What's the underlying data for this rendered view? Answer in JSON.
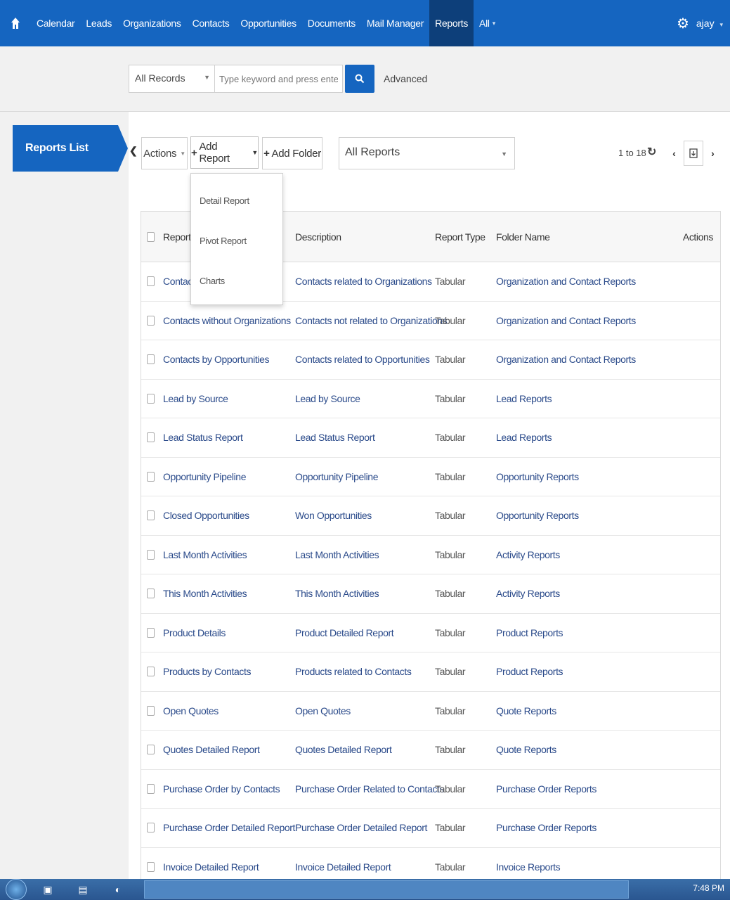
{
  "nav": {
    "items": [
      "Calendar",
      "Leads",
      "Organizations",
      "Contacts",
      "Opportunities",
      "Documents",
      "Mail Manager",
      "Reports",
      "All"
    ],
    "active": "Reports",
    "user": "ajay"
  },
  "search": {
    "records_select": "All Records",
    "placeholder": "Type keyword and press enter",
    "advanced_label": "Advanced"
  },
  "sidebar": {
    "title": "Reports List"
  },
  "toolbar": {
    "actions_label": "Actions",
    "add_report_label": "Add Report",
    "add_folder_label": "Add Folder",
    "folder_filter": "All Reports",
    "pager_text": "1 to 18"
  },
  "add_report_menu": [
    "Detail Report",
    "Pivot Report",
    "Charts"
  ],
  "table": {
    "headers": {
      "name": "Report Name",
      "description": "Description",
      "type": "Report Type",
      "folder": "Folder Name",
      "actions": "Actions"
    },
    "rows": [
      {
        "name": "Contacts by Organizations",
        "description": "Contacts related to Organizations",
        "type": "Tabular",
        "folder": "Organization and Contact Reports"
      },
      {
        "name": "Contacts without Organizations",
        "description": "Contacts not related to Organizations",
        "type": "Tabular",
        "folder": "Organization and Contact Reports"
      },
      {
        "name": "Contacts by Opportunities",
        "description": "Contacts related to Opportunities",
        "type": "Tabular",
        "folder": "Organization and Contact Reports"
      },
      {
        "name": "Lead by Source",
        "description": "Lead by Source",
        "type": "Tabular",
        "folder": "Lead Reports"
      },
      {
        "name": "Lead Status Report",
        "description": "Lead Status Report",
        "type": "Tabular",
        "folder": "Lead Reports"
      },
      {
        "name": "Opportunity Pipeline",
        "description": "Opportunity Pipeline",
        "type": "Tabular",
        "folder": "Opportunity Reports"
      },
      {
        "name": "Closed Opportunities",
        "description": "Won Opportunities",
        "type": "Tabular",
        "folder": "Opportunity Reports"
      },
      {
        "name": "Last Month Activities",
        "description": "Last Month Activities",
        "type": "Tabular",
        "folder": "Activity Reports"
      },
      {
        "name": "This Month Activities",
        "description": "This Month Activities",
        "type": "Tabular",
        "folder": "Activity Reports"
      },
      {
        "name": "Product Details",
        "description": "Product Detailed Report",
        "type": "Tabular",
        "folder": "Product Reports"
      },
      {
        "name": "Products by Contacts",
        "description": "Products related to Contacts",
        "type": "Tabular",
        "folder": "Product Reports"
      },
      {
        "name": "Open Quotes",
        "description": "Open Quotes",
        "type": "Tabular",
        "folder": "Quote Reports"
      },
      {
        "name": "Quotes Detailed Report",
        "description": "Quotes Detailed Report",
        "type": "Tabular",
        "folder": "Quote Reports"
      },
      {
        "name": "Purchase Order by Contacts",
        "description": "Purchase Order Related to Contacts",
        "type": "Tabular",
        "folder": "Purchase Order Reports"
      },
      {
        "name": "Purchase Order Detailed Report",
        "description": "Purchase Order Detailed Report",
        "type": "Tabular",
        "folder": "Purchase Order Reports"
      },
      {
        "name": "Invoice Detailed Report",
        "description": "Invoice Detailed Report",
        "type": "Tabular",
        "folder": "Invoice Reports"
      }
    ]
  },
  "taskbar": {
    "clock": "7:48 PM"
  },
  "colors": {
    "nav_bg": "#1565c0",
    "nav_active": "#0d3f7a",
    "link": "#2a4a8a",
    "panel_bg": "#f1f1f1"
  },
  "icons": [
    "home-icon",
    "gear-icon",
    "search-icon",
    "refresh-icon",
    "chevron-left-icon",
    "chevron-right-icon",
    "export-icon",
    "plus-icon"
  ]
}
